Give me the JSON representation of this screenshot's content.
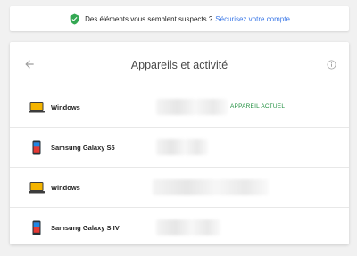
{
  "banner": {
    "text": "Des éléments vous semblent suspects ?",
    "link": "Sécurisez votre compte",
    "icon": "shield-check-icon",
    "icon_color": "#34a853"
  },
  "card": {
    "title": "Appareils et activité",
    "back_icon": "arrow-back-icon",
    "info_icon": "info-icon"
  },
  "devices": [
    {
      "name": "Windows",
      "icon": "laptop-icon",
      "badge": "APPAREIL ACTUEL"
    },
    {
      "name": "Samsung Galaxy S5",
      "icon": "phone-icon",
      "badge": ""
    },
    {
      "name": "Windows",
      "icon": "laptop-icon",
      "badge": ""
    },
    {
      "name": "Samsung Galaxy S IV",
      "icon": "phone-icon",
      "badge": ""
    }
  ],
  "colors": {
    "accent_link": "#3b78e7",
    "current_device": "#1e8e3e",
    "laptop": "#f4b400"
  }
}
